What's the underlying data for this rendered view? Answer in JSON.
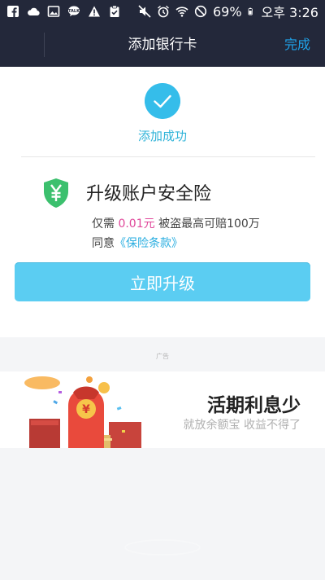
{
  "status_bar": {
    "battery": "69%",
    "time": "오후 3:26",
    "icons": [
      "facebook-icon",
      "cloud-icon",
      "gallery-icon",
      "talk-icon",
      "warning-icon",
      "clipboard-icon",
      "mute-icon",
      "alarm-icon",
      "wifi-icon",
      "no-signal-icon",
      "battery-icon"
    ]
  },
  "nav": {
    "title": "添加银行卡",
    "done_label": "完成"
  },
  "success": {
    "text": "添加成功",
    "icon": "check-circle-icon"
  },
  "insurance": {
    "icon": "yuan-shield-icon",
    "title": "升级账户安全险",
    "line1_prefix": "仅需",
    "price": "0.01元",
    "line1_suffix": "被盗最高可赔100万",
    "line2_prefix": "同意",
    "terms_link": "《保险条款》",
    "button_label": "立即升级"
  },
  "ad": {
    "label": "广告",
    "title": "活期利息少",
    "subtitle": "就放余额宝 收益不得了"
  },
  "colors": {
    "nav_bg": "#23283a",
    "accent": "#1fa3ea",
    "button": "#5bcdf2",
    "success": "#35bdea",
    "price": "#e0479a",
    "shield": "#3cc06e"
  }
}
